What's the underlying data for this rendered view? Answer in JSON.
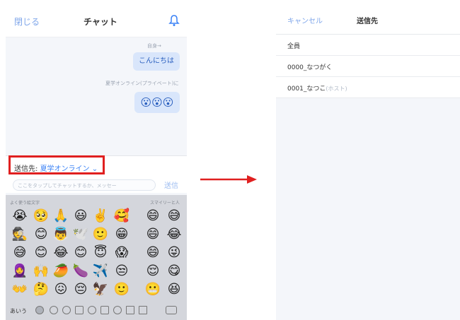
{
  "left": {
    "header": {
      "close": "閉じる",
      "title": "チャット",
      "bell_icon": "bell-icon"
    },
    "messages": [
      {
        "sender": "自身→",
        "text": "こんにちは"
      },
      {
        "sender": "夏学オンライン(プライベート)に",
        "text": "😮😮😮"
      }
    ],
    "composer": {
      "send_to_label": "送信先:",
      "send_to_value": "夏学オンライン",
      "placeholder": "ここをタップしてチャットするか、メッセー",
      "send": "送信"
    },
    "keyboard": {
      "frequent_label": "よく使う絵文字",
      "smileys_label": "スマイリーと人",
      "emojis": [
        "😭",
        "🥺",
        "🙏",
        "😃",
        "✌️",
        "🥰",
        "😄",
        "😅",
        "🕵️",
        "😊",
        "👼",
        "🕊️",
        "🙂",
        "😁",
        "😄",
        "😂",
        "😅",
        "😊",
        "😂",
        "😊",
        "😇",
        "😱",
        "😄",
        "😜",
        "🧕",
        "🙌",
        "🥭",
        "🍆",
        "✈️",
        "😒",
        "😌",
        "😋",
        "👐",
        "🤔",
        "😖",
        "😔",
        "🦅",
        "🙂",
        "😬",
        "😆"
      ],
      "abc": "あいう"
    }
  },
  "right": {
    "header": {
      "cancel": "キャンセル",
      "title": "送信先"
    },
    "recipients": [
      {
        "name": "全員",
        "tag": ""
      },
      {
        "name": "0000_なつがく",
        "tag": ""
      },
      {
        "name": "0001_なつこ",
        "tag": "(ホスト)"
      }
    ]
  },
  "colors": {
    "accent": "#3b82f6",
    "highlight": "#e02020"
  }
}
